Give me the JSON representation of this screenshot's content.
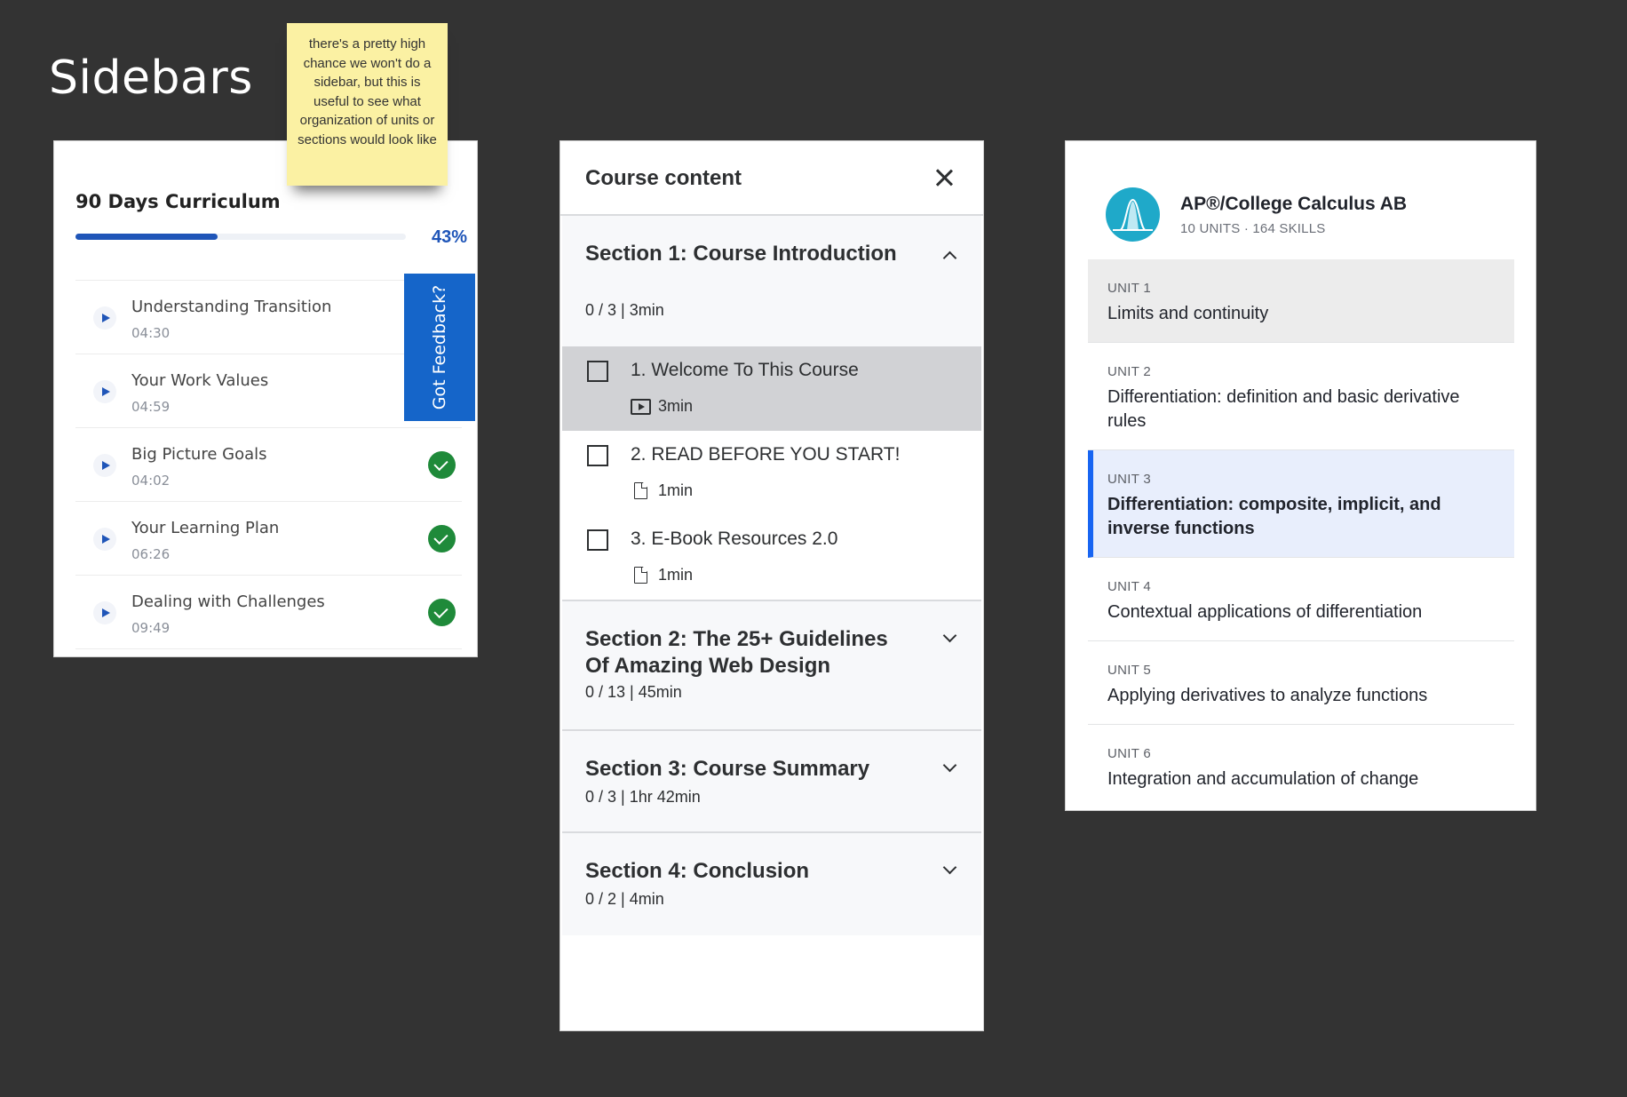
{
  "page": {
    "title": "Sidebars"
  },
  "sticky_note": {
    "text": "there's a pretty high chance we won't do a sidebar, but this is useful to see what organization of units or sections would look like"
  },
  "curriculum": {
    "title": "90 Days Curriculum",
    "progress": 0.43,
    "progress_label": "43%",
    "feedback_label": "Got Feedback?",
    "items": [
      {
        "name": "Understanding Transition",
        "time": "04:30",
        "completed": false
      },
      {
        "name": "Your Work Values",
        "time": "04:59",
        "completed": false
      },
      {
        "name": "Big Picture Goals",
        "time": "04:02",
        "completed": true
      },
      {
        "name": "Your Learning Plan",
        "time": "06:26",
        "completed": true
      },
      {
        "name": "Dealing with Challenges",
        "time": "09:49",
        "completed": true
      }
    ]
  },
  "course": {
    "header": "Course content",
    "sections": [
      {
        "title": "Section 1: Course Introduction",
        "meta": "0 / 3 | 3min",
        "expanded": true
      },
      {
        "title": "Section 2: The 25+ Guidelines Of Amazing Web Design",
        "meta": "0 / 13 | 45min",
        "expanded": false
      },
      {
        "title": "Section 3: Course Summary",
        "meta": "0 / 3 | 1hr 42min",
        "expanded": false
      },
      {
        "title": "Section 4: Conclusion",
        "meta": "0 / 2 | 4min",
        "expanded": false
      }
    ],
    "lectures": [
      {
        "title": "1. Welcome To This Course",
        "duration": "3min",
        "icon": "video-icon",
        "active": true
      },
      {
        "title": "2. READ BEFORE YOU START!",
        "duration": "1min",
        "icon": "file-icon",
        "active": false
      },
      {
        "title": "3. E-Book Resources 2.0",
        "duration": "1min",
        "icon": "file-icon",
        "active": false
      }
    ]
  },
  "units_panel": {
    "course_title": "AP®/College Calculus AB",
    "course_sub": "10 UNITS · 164 SKILLS",
    "accent_color": "#1865f2",
    "units": [
      {
        "label": "UNIT 1",
        "name": "Limits and continuity",
        "state": "gray"
      },
      {
        "label": "UNIT 2",
        "name": "Differentiation: definition and basic derivative rules",
        "state": "normal"
      },
      {
        "label": "UNIT 3",
        "name": "Differentiation: composite, implicit, and inverse functions",
        "state": "selected"
      },
      {
        "label": "UNIT 4",
        "name": "Contextual applications of differentiation",
        "state": "normal"
      },
      {
        "label": "UNIT 5",
        "name": "Applying derivatives to analyze functions",
        "state": "normal"
      },
      {
        "label": "UNIT 6",
        "name": "Integration and accumulation of change",
        "state": "normal"
      }
    ]
  }
}
